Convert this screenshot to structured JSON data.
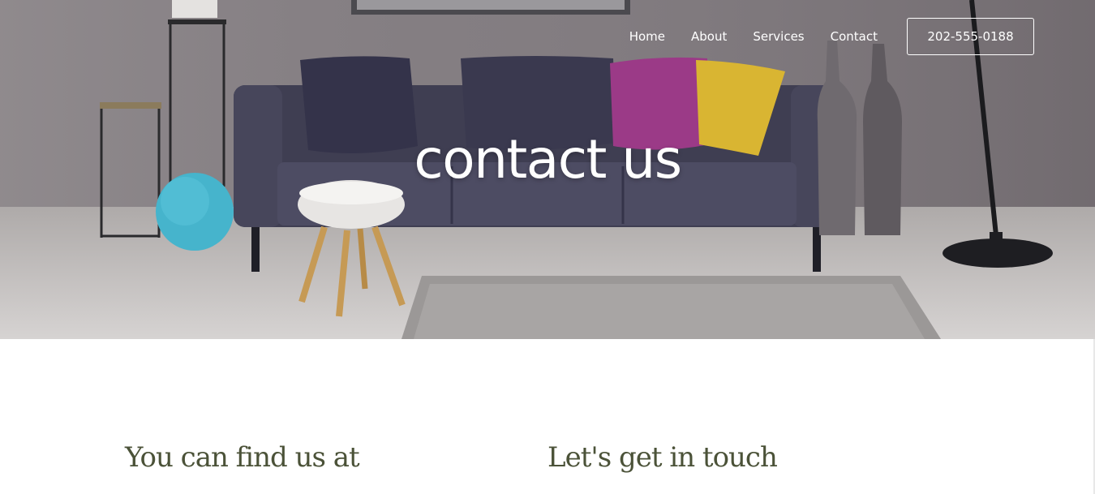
{
  "nav": {
    "links": [
      "Home",
      "About",
      "Services",
      "Contact"
    ],
    "phone": "202-555-0188"
  },
  "hero": {
    "title": "contact us"
  },
  "sections": {
    "find_us_heading": "You can find us at",
    "get_in_touch_heading": "Let's get in touch"
  },
  "colors": {
    "heading": "#4b5238",
    "nav_text": "#ffffff",
    "sofa": "#3f3e52",
    "pillow_magenta": "#9b3a87",
    "pillow_yellow": "#d9b532",
    "ball_teal": "#46b4cc"
  },
  "icons": []
}
